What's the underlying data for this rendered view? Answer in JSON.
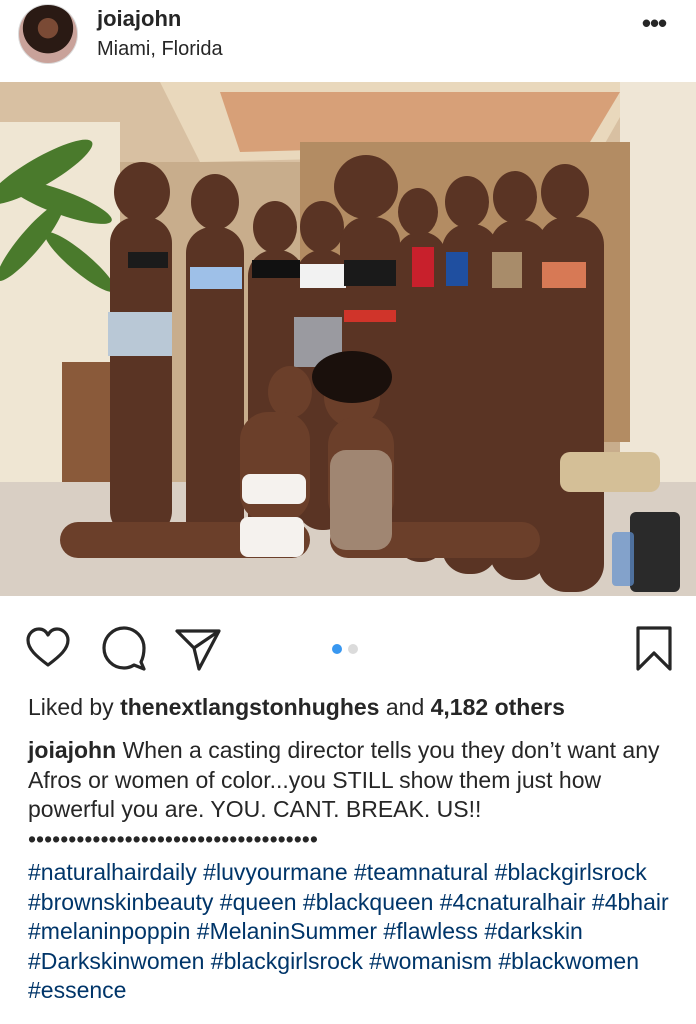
{
  "post": {
    "username": "joiajohn",
    "location": "Miami, Florida",
    "more_icon": "more-horizontal-icon"
  },
  "photo": {
    "description_alt": "photo"
  },
  "actions": {
    "like_icon": "heart-icon",
    "comment_icon": "comment-bubble-icon",
    "share_icon": "paper-plane-icon",
    "save_icon": "bookmark-icon",
    "carousel_count": 2,
    "carousel_active": 1
  },
  "likes": {
    "prefix": "Liked by",
    "user": "thenextlangstonhughes",
    "conjunction": "and",
    "others": "4,182 others"
  },
  "caption": {
    "user": "joiajohn",
    "text": "When a casting director tells you they don’t want any Afros or women of color...you STILL show them just how powerful you are. YOU. CANT. BREAK. US!! ••••••••••••••••••••••••••••••••••••",
    "hashtags": "#naturalhairdaily #luvyourmane #teamnatural #blackgirlsrock #brownskinbeauty #queen #blackqueen #4cnaturalhair #4bhair #melaninpoppin #MelaninSummer #flawless #darkskin #Darkskinwomen #blackgirlsrock #womanism #blackwomen #essence"
  },
  "colors": {
    "text": "#262626",
    "hashtag": "#003569",
    "carousel_active": "#3897f0",
    "carousel_inactive": "#dbdbdb"
  }
}
